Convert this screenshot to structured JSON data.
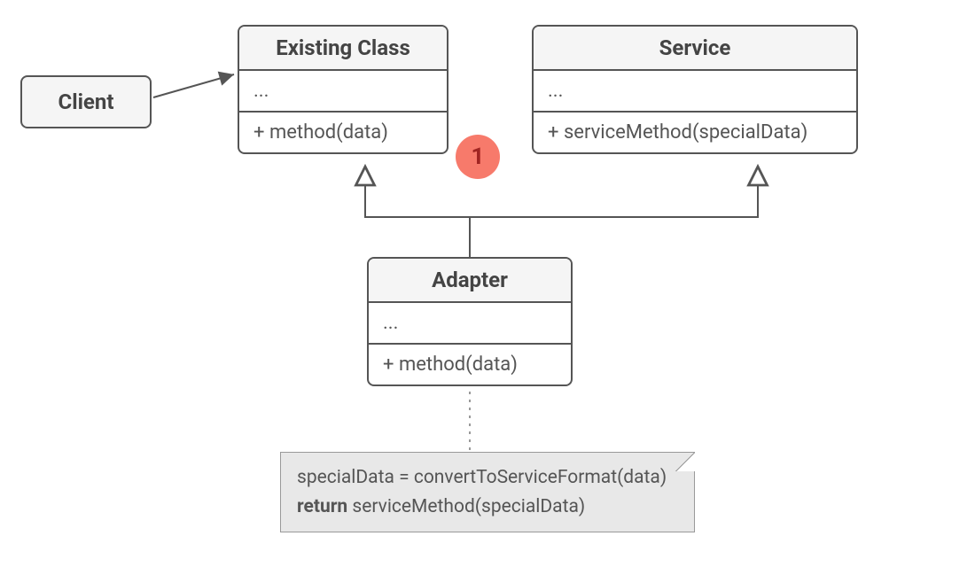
{
  "client": {
    "title": "Client"
  },
  "existing": {
    "title": "Existing Class",
    "attrs": "...",
    "method": "+ method(data)"
  },
  "service": {
    "title": "Service",
    "attrs": "...",
    "method": "+ serviceMethod(specialData)"
  },
  "adapter": {
    "title": "Adapter",
    "attrs": "...",
    "method": "+ method(data)"
  },
  "note": {
    "line1_pre": "specialData = convertToServiceFormat(data)",
    "line2_strong": "return",
    "line2_rest": " serviceMethod(specialData)"
  },
  "badge": "1"
}
